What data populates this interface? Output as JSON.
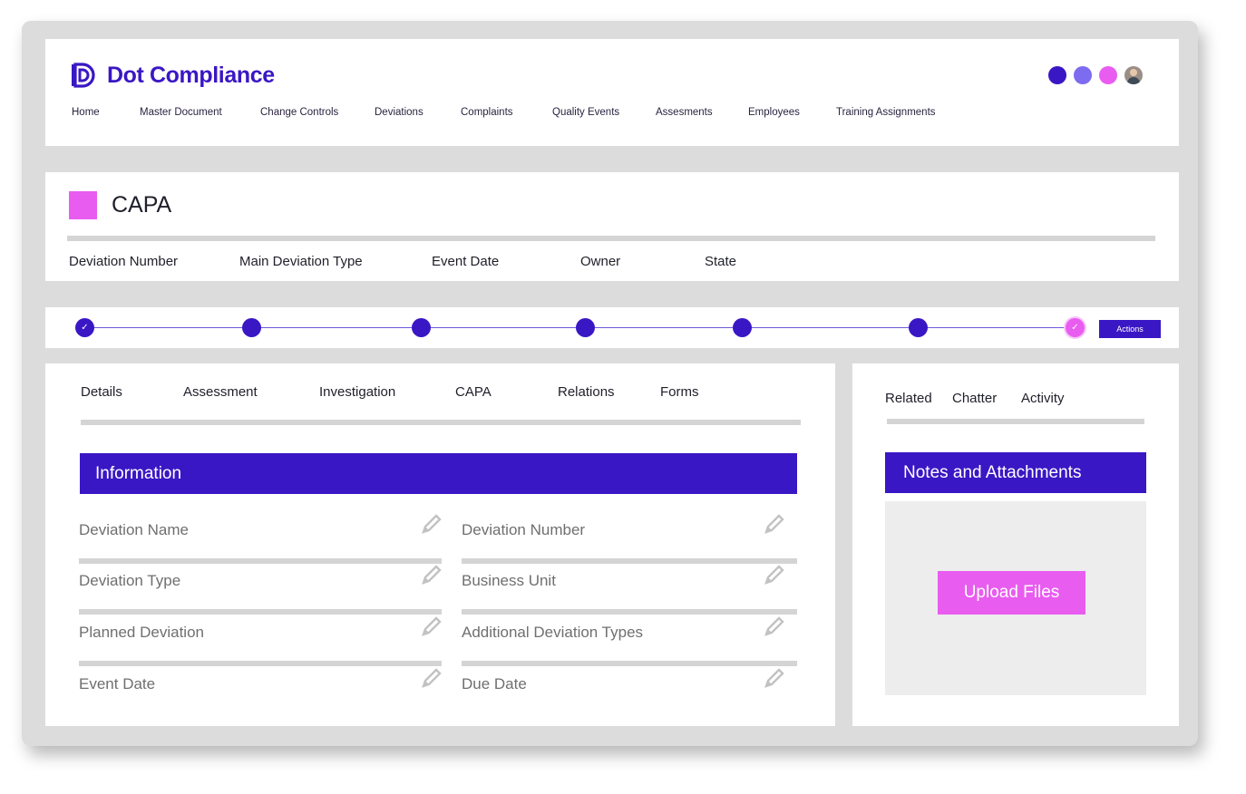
{
  "brand": {
    "name": "Dot Compliance",
    "accent": "#3a17c4",
    "pink": "#e95cf0",
    "light_purple": "#7d6bf0",
    "mid_pink": "#e95cf0"
  },
  "nav": {
    "items": [
      {
        "label": "Home"
      },
      {
        "label": "Master Document"
      },
      {
        "label": "Change Controls"
      },
      {
        "label": "Deviations"
      },
      {
        "label": "Complaints"
      },
      {
        "label": "Quality Events"
      },
      {
        "label": "Assesments"
      },
      {
        "label": "Employees"
      },
      {
        "label": "Training Assignments"
      }
    ]
  },
  "header_dots": [
    {
      "color": "#3a17c4"
    },
    {
      "color": "#7d6bf0"
    },
    {
      "color": "#e95cf0"
    }
  ],
  "record": {
    "title": "CAPA",
    "fields": [
      "Deviation Number",
      "Main Deviation Type",
      "Event Date",
      "Owner",
      "State"
    ]
  },
  "progress": {
    "steps": [
      {
        "status": "done"
      },
      {
        "status": "pending"
      },
      {
        "status": "pending"
      },
      {
        "status": "pending"
      },
      {
        "status": "pending"
      },
      {
        "status": "pending"
      },
      {
        "status": "current"
      }
    ],
    "actions_label": "Actions"
  },
  "main": {
    "tabs": [
      "Details",
      "Assessment",
      "Investigation",
      "CAPA",
      "Relations",
      "Forms"
    ],
    "section_title": "Information",
    "fields_left": [
      "Deviation Name",
      "Deviation Type",
      "Planned Deviation",
      "Event Date"
    ],
    "fields_right": [
      "Deviation Number",
      "Business Unit",
      "Additional Deviation Types",
      "Due Date"
    ]
  },
  "side": {
    "tabs": [
      "Related",
      "Chatter",
      "Activity"
    ],
    "section_title": "Notes and Attachments",
    "upload_label": "Upload Files"
  }
}
